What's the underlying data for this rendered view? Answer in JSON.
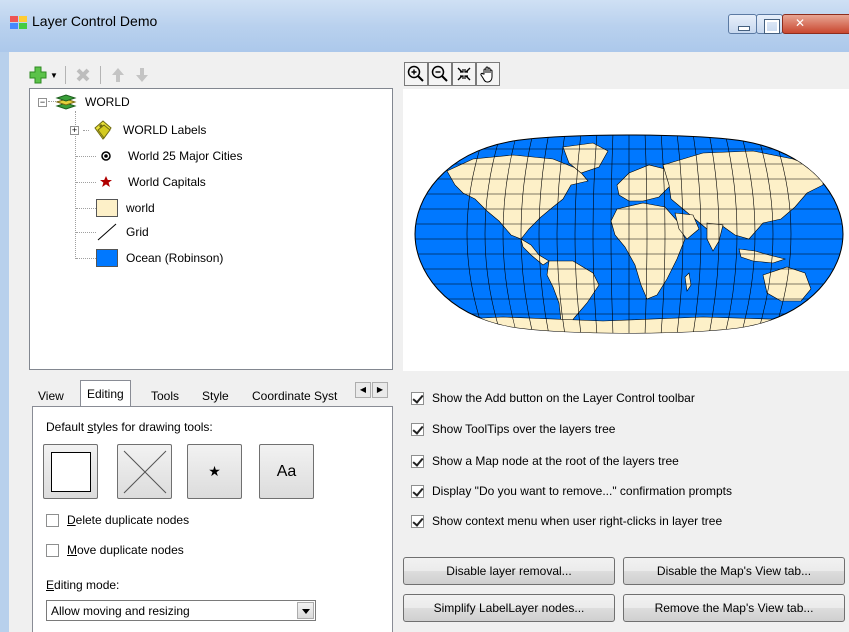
{
  "window": {
    "title": "Layer Control Demo"
  },
  "layer_tree": {
    "root": "WORLD",
    "layers": [
      {
        "label": "WORLD Labels",
        "icon": "labels-icon"
      },
      {
        "label": "World 25 Major Cities",
        "icon": "point-icon"
      },
      {
        "label": "World Capitals",
        "icon": "star-icon"
      },
      {
        "label": "world",
        "icon": "polygon-fill-icon",
        "color": "#fdf0c8"
      },
      {
        "label": "Grid",
        "icon": "line-icon"
      },
      {
        "label": "Ocean (Robinson)",
        "icon": "polygon-fill-icon",
        "color": "#0078ff"
      }
    ]
  },
  "tabs": {
    "items": [
      "View",
      "Editing",
      "Tools",
      "Style",
      "Coordinate Syst"
    ],
    "active": "Editing"
  },
  "editing": {
    "default_styles_label_pre": "Default ",
    "default_styles_label_key": "s",
    "default_styles_label_post": "tyles for drawing tools:",
    "style_text_sample": "Aa",
    "delete_dup_key": "D",
    "delete_dup_rest": "elete duplicate nodes",
    "move_dup_key": "M",
    "move_dup_rest": "ove duplicate nodes",
    "mode_label_key": "E",
    "mode_label_rest": "diting mode:",
    "mode_value": "Allow moving and resizing"
  },
  "options": [
    {
      "label": "Show the Add button on the Layer Control toolbar",
      "checked": true
    },
    {
      "label": "Show ToolTips over the layers tree",
      "checked": true
    },
    {
      "label": "Show a Map node at the root of the layers tree",
      "checked": true
    },
    {
      "label": "Display \"Do you want to remove...\" confirmation prompts",
      "checked": true
    },
    {
      "label": "Show context menu when user right-clicks in layer tree",
      "checked": true
    }
  ],
  "buttons": {
    "disable_removal": "Disable layer removal...",
    "disable_view_tab": "Disable the Map's View tab...",
    "simplify_label": "Simplify LabelLayer nodes...",
    "remove_view_tab": "Remove the Map's View tab..."
  },
  "colors": {
    "ocean": "#0078ff",
    "land": "#fdf0c8",
    "selection": "#3399ff"
  },
  "map_tools": [
    "zoom-in-icon",
    "zoom-out-icon",
    "full-extent-icon",
    "pan-icon"
  ]
}
